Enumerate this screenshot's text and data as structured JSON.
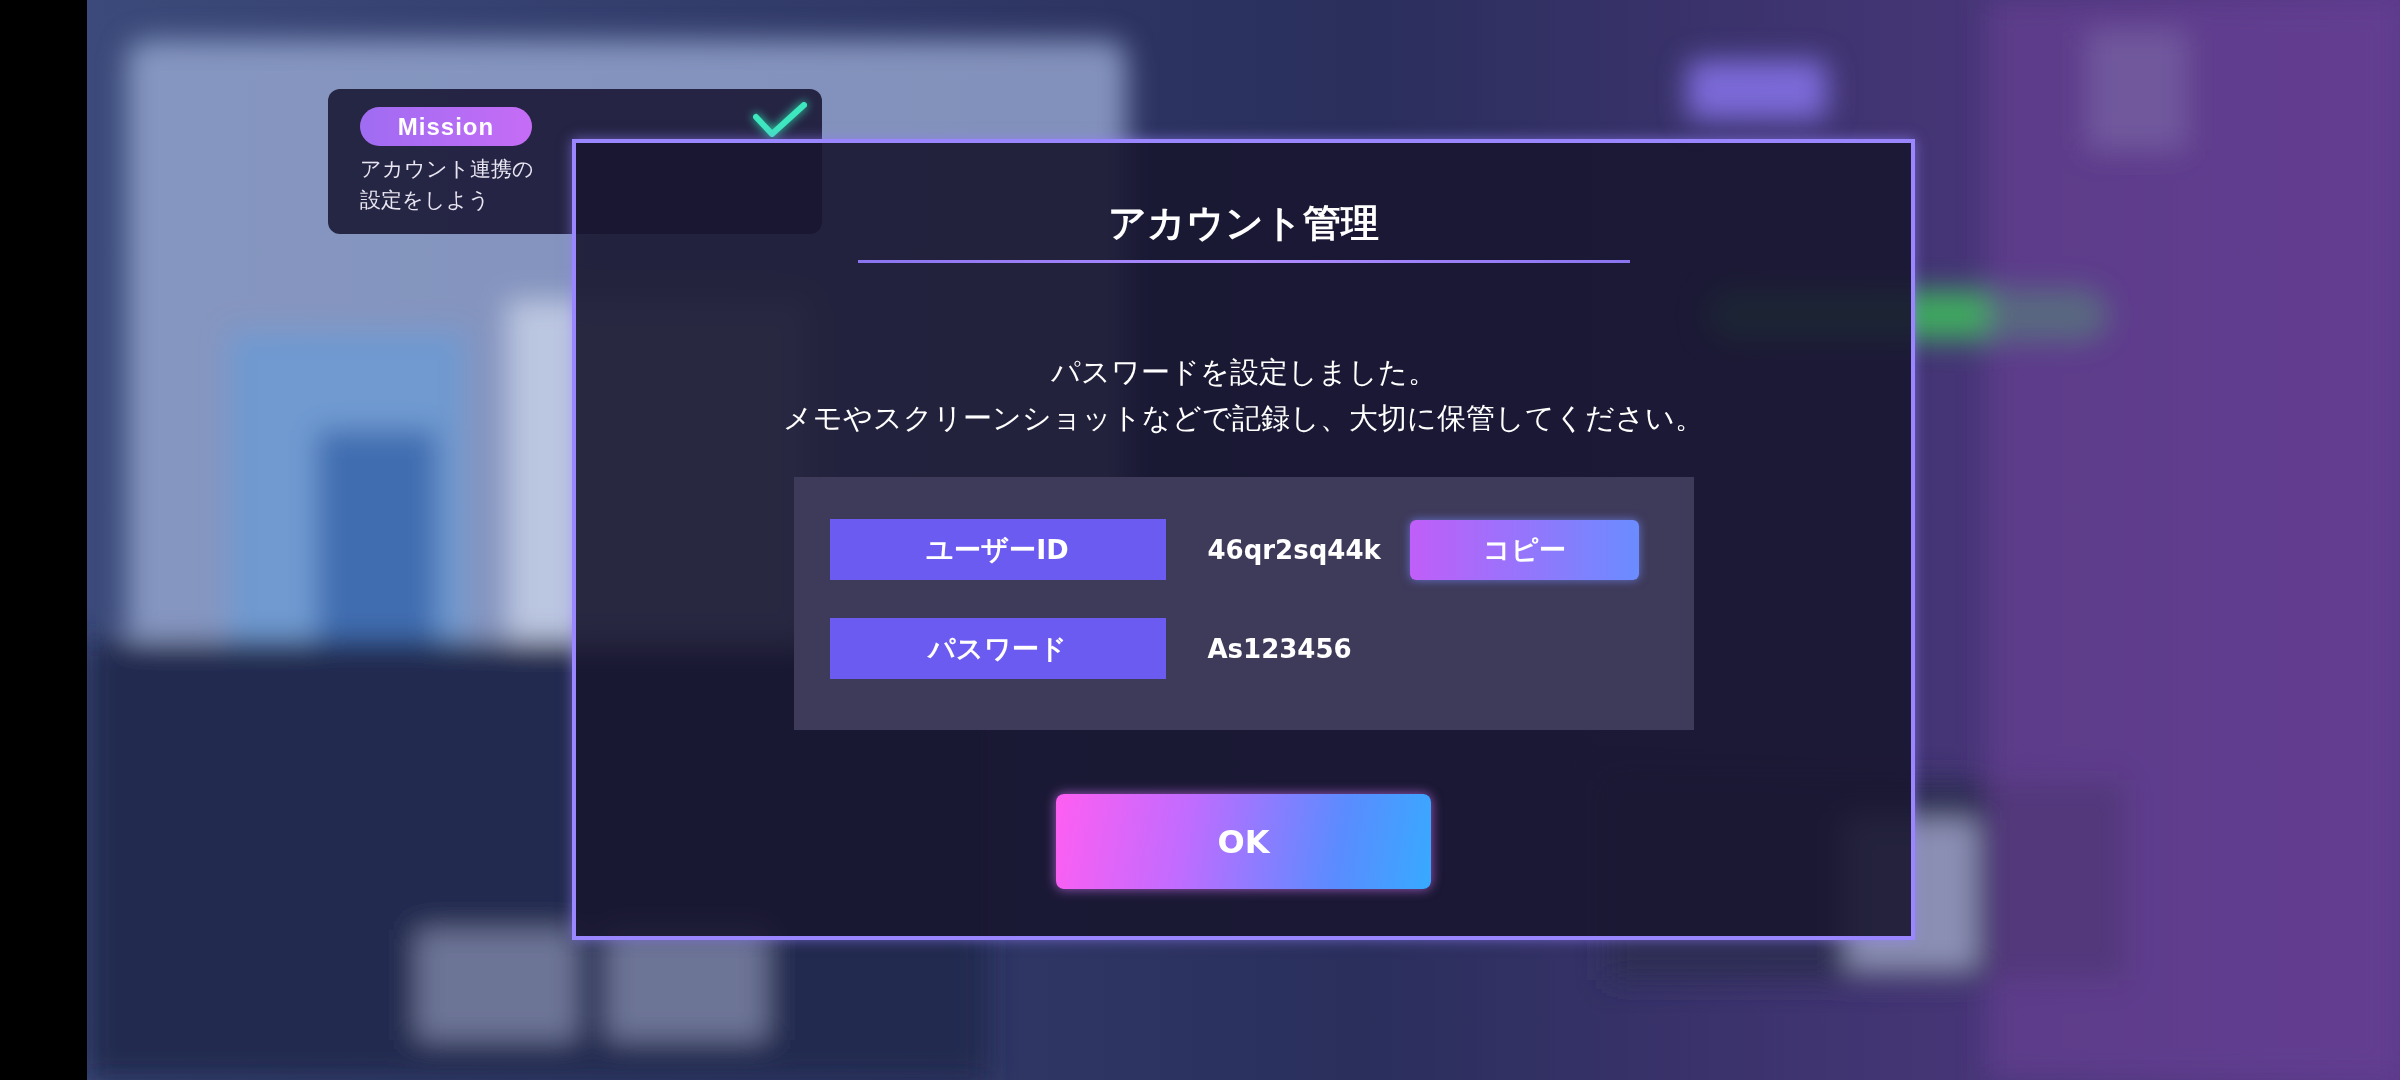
{
  "mission": {
    "badge": "Mission",
    "lines": [
      "アカウント連携の",
      "設定をしよう"
    ],
    "completed": true
  },
  "dialog": {
    "title": "アカウント管理",
    "message_lines": [
      "パスワードを設定しました。",
      "メモやスクリーンショットなどで記録し、大切に保管してください。"
    ],
    "fields": [
      {
        "label": "ユーザーID",
        "value": "46qr2sq44k",
        "action": "コピー"
      },
      {
        "label": "パスワード",
        "value": "As123456"
      }
    ],
    "ok": "OK"
  }
}
